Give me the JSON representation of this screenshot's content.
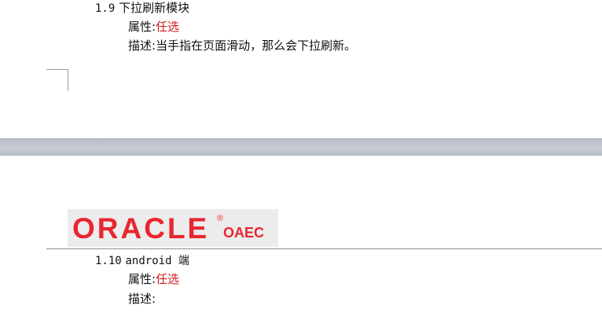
{
  "section_1_9": {
    "number": "1.9",
    "title": "下拉刷新模块",
    "attr_label": "属性:",
    "attr_value": "任选",
    "desc_label": "描述:",
    "desc_value": "当手指在页面滑动，那么会下拉刷新。"
  },
  "logo": {
    "brand": "ORACLE",
    "registered": "®",
    "sub": "OAEC"
  },
  "section_1_10": {
    "number": "1.10",
    "title": "android 端",
    "attr_label": "属性:",
    "attr_value": "任选",
    "desc_label": "描述:",
    "desc_value": ""
  },
  "colors": {
    "accent_red": "#d41b1b",
    "brand_red": "#e8262e",
    "page_gap": "#c2c6ce"
  }
}
